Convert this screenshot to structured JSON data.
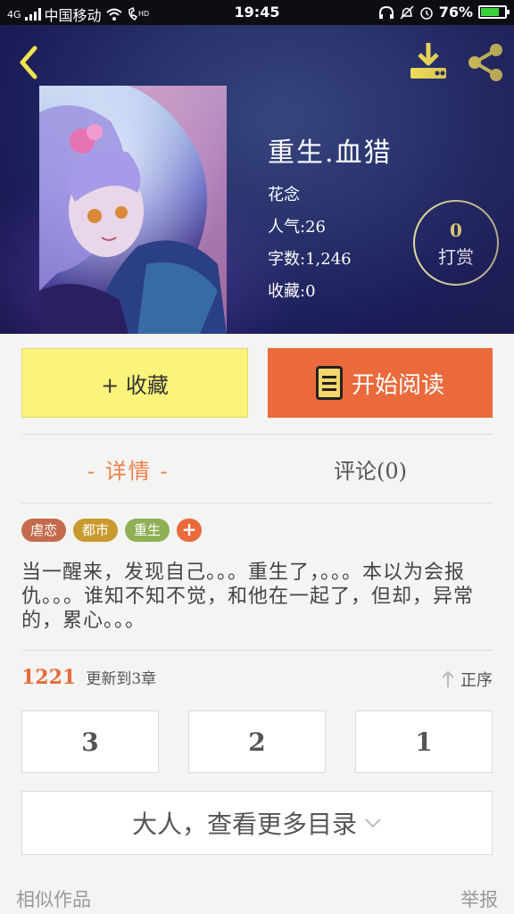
{
  "status_bar": {
    "carrier": "中国移动",
    "network": "4G",
    "time": "19:45",
    "battery": "76%",
    "battery_level": 0.76
  },
  "header": {
    "back_icon": "chevron-left-icon",
    "download_icon": "download-icon",
    "share_icon": "share-icon"
  },
  "book": {
    "title": "重生.血猎",
    "author": "花念",
    "popularity": "人气:26",
    "word_count": "字数:1,246",
    "favorites": "收藏:0"
  },
  "reward": {
    "count": "0",
    "label": "打赏"
  },
  "actions": {
    "favorite_label": "+ 收藏",
    "read_label": "开始阅读"
  },
  "tabs": {
    "detail": "- 详情 -",
    "comments": "评论(0)"
  },
  "tags": [
    {
      "label": "虐恋",
      "color": "#c46b4d"
    },
    {
      "label": "都市",
      "color": "#c99a2e"
    },
    {
      "label": "重生",
      "color": "#8fb055"
    }
  ],
  "tag_add": "+",
  "description": "当一醒来，发现自己。。。重生了，。。。本以为会报仇。。。谁知不知不觉，和他在一起了，但却，异常的，累心。。。",
  "updates": {
    "count": "1221",
    "text": "更新到3章",
    "sort_label": "正序"
  },
  "chapters": [
    "3",
    "2",
    "1"
  ],
  "catalog_label": "大人，查看更多目录",
  "footer": {
    "similar": "相似作品",
    "report": "举报"
  },
  "colors": {
    "accent_orange": "#ea6a3c",
    "fav_yellow": "#fbf37a",
    "header_navy": "#1b1c58"
  }
}
